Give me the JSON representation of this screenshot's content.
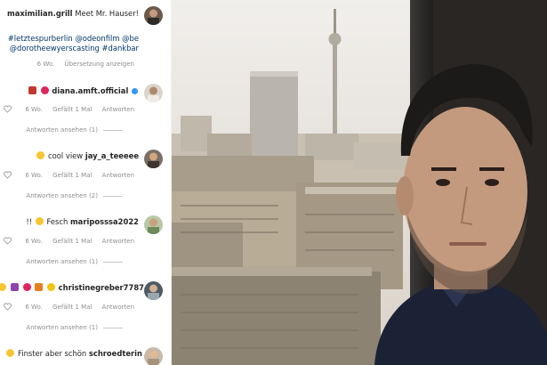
{
  "post": {
    "author": "maximilian.grill",
    "caption": "Meet Mr. Hauser!",
    "hashtags_line1": "#letztespurberlin @odeonfilm @be",
    "hashtags_line2": "@dorotheewyerscasting #dankbar",
    "age": "6 Wo.",
    "translate_label": "Übersetzung anzeigen"
  },
  "comments": [
    {
      "user": "diana.amft.official",
      "text": "",
      "age": "6 Wo.",
      "likes": "Gefällt 1 Mal",
      "reply": "Antworten",
      "view_replies": "Antworten ansehen (1)"
    },
    {
      "user": "jay_a_teeeee",
      "text": "cool view",
      "age": "6 Wo.",
      "likes": "Gefällt 1 Mal",
      "reply": "Antworten",
      "view_replies": "Antworten ansehen (2)"
    },
    {
      "user": "mariposssa2022",
      "text": "Fesch",
      "text_suffix": "!!",
      "age": "6 Wo.",
      "likes": "Gefällt 1 Mal",
      "reply": "Antworten",
      "view_replies": "Antworten ansehen (1)"
    },
    {
      "user": "christinegreber7787",
      "text": "",
      "age": "6 Wo.",
      "likes": "Gefällt 1 Mal",
      "reply": "Antworten",
      "view_replies": "Antworten ansehen (1)"
    },
    {
      "user": "schroedterin",
      "text": "Finster aber schön",
      "age": "",
      "likes": "",
      "reply": "",
      "view_replies": ""
    }
  ],
  "colors": {
    "link": "#00376b",
    "meta": "#8e8e8e",
    "verified": "#3897f0",
    "heart": "#ed4956"
  },
  "icons": [
    "heart-icon",
    "verified-badge-icon",
    "emoji-icon"
  ]
}
